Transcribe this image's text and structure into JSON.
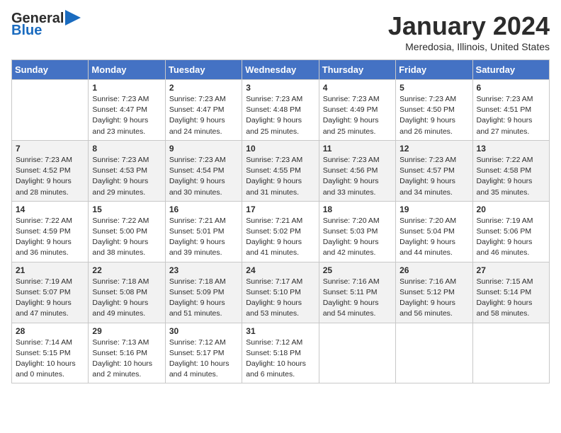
{
  "header": {
    "logo_line1": "General",
    "logo_line2": "Blue",
    "month_title": "January 2024",
    "location": "Meredosia, Illinois, United States"
  },
  "days_of_week": [
    "Sunday",
    "Monday",
    "Tuesday",
    "Wednesday",
    "Thursday",
    "Friday",
    "Saturday"
  ],
  "weeks": [
    [
      {
        "day": "",
        "info": ""
      },
      {
        "day": "1",
        "info": "Sunrise: 7:23 AM\nSunset: 4:47 PM\nDaylight: 9 hours\nand 23 minutes."
      },
      {
        "day": "2",
        "info": "Sunrise: 7:23 AM\nSunset: 4:47 PM\nDaylight: 9 hours\nand 24 minutes."
      },
      {
        "day": "3",
        "info": "Sunrise: 7:23 AM\nSunset: 4:48 PM\nDaylight: 9 hours\nand 25 minutes."
      },
      {
        "day": "4",
        "info": "Sunrise: 7:23 AM\nSunset: 4:49 PM\nDaylight: 9 hours\nand 25 minutes."
      },
      {
        "day": "5",
        "info": "Sunrise: 7:23 AM\nSunset: 4:50 PM\nDaylight: 9 hours\nand 26 minutes."
      },
      {
        "day": "6",
        "info": "Sunrise: 7:23 AM\nSunset: 4:51 PM\nDaylight: 9 hours\nand 27 minutes."
      }
    ],
    [
      {
        "day": "7",
        "info": "Sunrise: 7:23 AM\nSunset: 4:52 PM\nDaylight: 9 hours\nand 28 minutes."
      },
      {
        "day": "8",
        "info": "Sunrise: 7:23 AM\nSunset: 4:53 PM\nDaylight: 9 hours\nand 29 minutes."
      },
      {
        "day": "9",
        "info": "Sunrise: 7:23 AM\nSunset: 4:54 PM\nDaylight: 9 hours\nand 30 minutes."
      },
      {
        "day": "10",
        "info": "Sunrise: 7:23 AM\nSunset: 4:55 PM\nDaylight: 9 hours\nand 31 minutes."
      },
      {
        "day": "11",
        "info": "Sunrise: 7:23 AM\nSunset: 4:56 PM\nDaylight: 9 hours\nand 33 minutes."
      },
      {
        "day": "12",
        "info": "Sunrise: 7:23 AM\nSunset: 4:57 PM\nDaylight: 9 hours\nand 34 minutes."
      },
      {
        "day": "13",
        "info": "Sunrise: 7:22 AM\nSunset: 4:58 PM\nDaylight: 9 hours\nand 35 minutes."
      }
    ],
    [
      {
        "day": "14",
        "info": "Sunrise: 7:22 AM\nSunset: 4:59 PM\nDaylight: 9 hours\nand 36 minutes."
      },
      {
        "day": "15",
        "info": "Sunrise: 7:22 AM\nSunset: 5:00 PM\nDaylight: 9 hours\nand 38 minutes."
      },
      {
        "day": "16",
        "info": "Sunrise: 7:21 AM\nSunset: 5:01 PM\nDaylight: 9 hours\nand 39 minutes."
      },
      {
        "day": "17",
        "info": "Sunrise: 7:21 AM\nSunset: 5:02 PM\nDaylight: 9 hours\nand 41 minutes."
      },
      {
        "day": "18",
        "info": "Sunrise: 7:20 AM\nSunset: 5:03 PM\nDaylight: 9 hours\nand 42 minutes."
      },
      {
        "day": "19",
        "info": "Sunrise: 7:20 AM\nSunset: 5:04 PM\nDaylight: 9 hours\nand 44 minutes."
      },
      {
        "day": "20",
        "info": "Sunrise: 7:19 AM\nSunset: 5:06 PM\nDaylight: 9 hours\nand 46 minutes."
      }
    ],
    [
      {
        "day": "21",
        "info": "Sunrise: 7:19 AM\nSunset: 5:07 PM\nDaylight: 9 hours\nand 47 minutes."
      },
      {
        "day": "22",
        "info": "Sunrise: 7:18 AM\nSunset: 5:08 PM\nDaylight: 9 hours\nand 49 minutes."
      },
      {
        "day": "23",
        "info": "Sunrise: 7:18 AM\nSunset: 5:09 PM\nDaylight: 9 hours\nand 51 minutes."
      },
      {
        "day": "24",
        "info": "Sunrise: 7:17 AM\nSunset: 5:10 PM\nDaylight: 9 hours\nand 53 minutes."
      },
      {
        "day": "25",
        "info": "Sunrise: 7:16 AM\nSunset: 5:11 PM\nDaylight: 9 hours\nand 54 minutes."
      },
      {
        "day": "26",
        "info": "Sunrise: 7:16 AM\nSunset: 5:12 PM\nDaylight: 9 hours\nand 56 minutes."
      },
      {
        "day": "27",
        "info": "Sunrise: 7:15 AM\nSunset: 5:14 PM\nDaylight: 9 hours\nand 58 minutes."
      }
    ],
    [
      {
        "day": "28",
        "info": "Sunrise: 7:14 AM\nSunset: 5:15 PM\nDaylight: 10 hours\nand 0 minutes."
      },
      {
        "day": "29",
        "info": "Sunrise: 7:13 AM\nSunset: 5:16 PM\nDaylight: 10 hours\nand 2 minutes."
      },
      {
        "day": "30",
        "info": "Sunrise: 7:12 AM\nSunset: 5:17 PM\nDaylight: 10 hours\nand 4 minutes."
      },
      {
        "day": "31",
        "info": "Sunrise: 7:12 AM\nSunset: 5:18 PM\nDaylight: 10 hours\nand 6 minutes."
      },
      {
        "day": "",
        "info": ""
      },
      {
        "day": "",
        "info": ""
      },
      {
        "day": "",
        "info": ""
      }
    ]
  ]
}
